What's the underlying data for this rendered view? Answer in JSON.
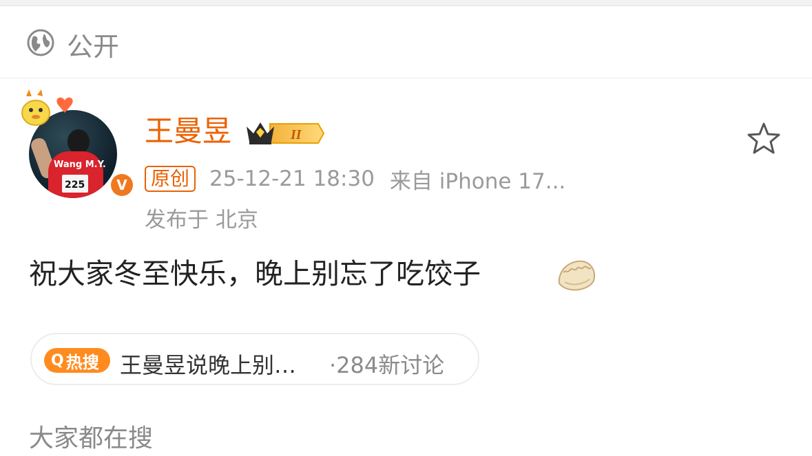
{
  "visibility": {
    "icon": "globe-icon",
    "label": "公开"
  },
  "post": {
    "author": {
      "name": "王曼昱",
      "avatar_jersey_name": "Wang M.Y.",
      "avatar_bib_number": "225",
      "verified_badge": "V",
      "crown_level": "II"
    },
    "original_tag": "原创",
    "time": "25-12-21 18:30",
    "source": "来自 iPhone 17...",
    "location": "发布于 北京",
    "text": "祝大家冬至快乐，晚上别忘了吃饺子",
    "emoji": "dumpling-icon"
  },
  "hot_search": {
    "badge_icon": "search-icon",
    "badge_label": "热搜",
    "title": "王曼昱说晚上别…",
    "count": "·284新讨论"
  },
  "section": {
    "title": "大家都在搜"
  },
  "colors": {
    "accent": "#eb6100",
    "hot_badge": "#ff8b1f",
    "muted": "#9a9a9a"
  }
}
